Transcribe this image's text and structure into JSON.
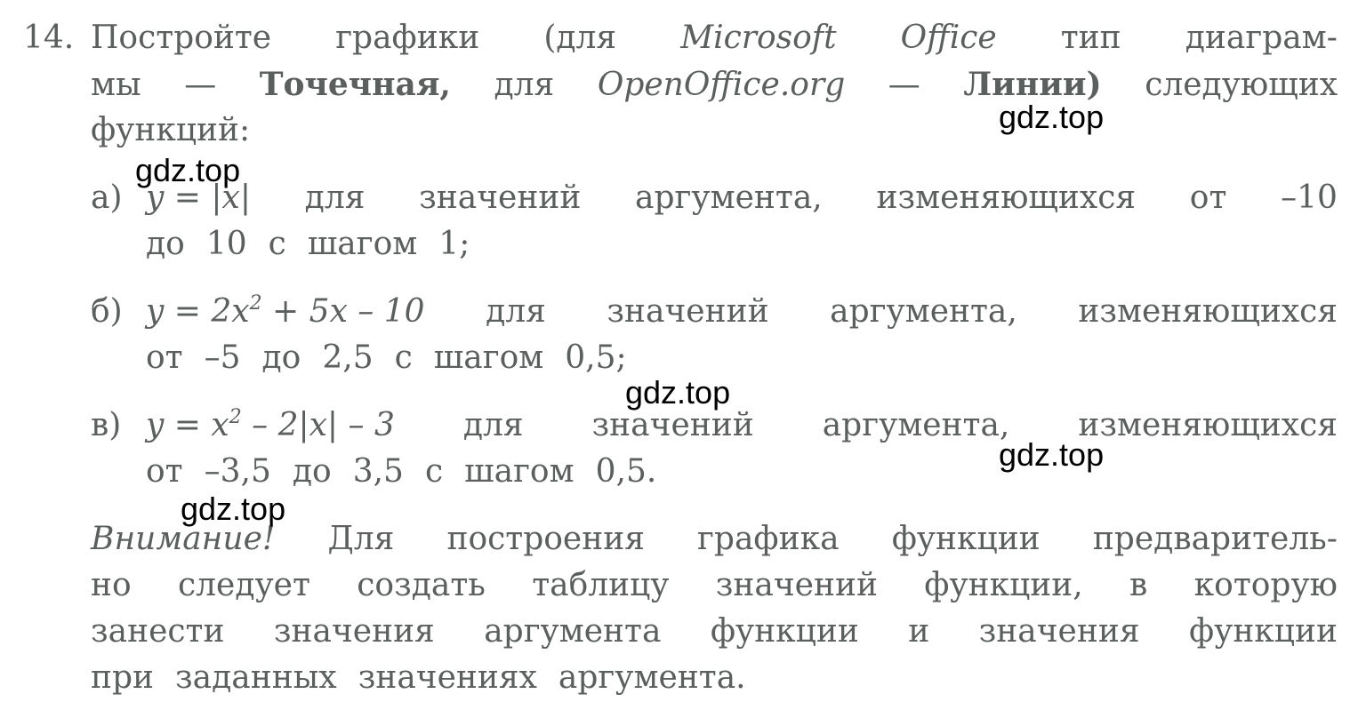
{
  "task": {
    "number": "14.",
    "intro_line1": [
      "Постройте",
      "графики",
      "(для",
      "Microsoft",
      "Office",
      "тип",
      "диаграм-"
    ],
    "intro_line2": [
      "мы",
      "—",
      "Точечная,",
      "для",
      "OpenOffice.org",
      "—",
      "Линии)",
      "следующих"
    ],
    "intro_line3": "функций:"
  },
  "items": [
    {
      "label": "а)",
      "formula": "y = |x|",
      "line1_rest": [
        "для",
        "значений",
        "аргумента,",
        "изменяющихся",
        "от",
        "–10"
      ],
      "line2": [
        "до",
        "10",
        "с",
        "шагом",
        "1;"
      ]
    },
    {
      "label": "б)",
      "formula_base": "y = 2x",
      "formula_sup": "2",
      "formula_tail": " + 5x – 10",
      "line1_rest": [
        "для",
        "значений",
        "аргумента,",
        "изменяющихся"
      ],
      "line2": [
        "от",
        "–5",
        "до",
        "2,5",
        "с",
        "шагом",
        "0,5;"
      ]
    },
    {
      "label": "в)",
      "formula_base": "y = x",
      "formula_sup": "2",
      "formula_tail": " – 2|x| – 3",
      "line1_rest": [
        "для",
        "значений",
        "аргумента,",
        "изменяющихся"
      ],
      "line2": [
        "от",
        "–3,5",
        "до",
        "3,5",
        "с",
        "шагом",
        "0,5."
      ]
    }
  ],
  "note": {
    "line1_lead": "Внимание!",
    "line1": [
      "Для",
      "построения",
      "графика",
      "функции",
      "предваритель-"
    ],
    "line2": [
      "но",
      "следует",
      "создать",
      "таблицу",
      "значений",
      "функции,",
      "в",
      "которую"
    ],
    "line3": [
      "занести",
      "значения",
      "аргумента",
      "функции",
      "и",
      "значения",
      "функции"
    ],
    "line4": [
      "при",
      "заданных",
      "значениях",
      "аргумента."
    ]
  },
  "watermarks": [
    "gdz.top",
    "gdz.top",
    "gdz.top",
    "gdz.top",
    "gdz.top"
  ]
}
